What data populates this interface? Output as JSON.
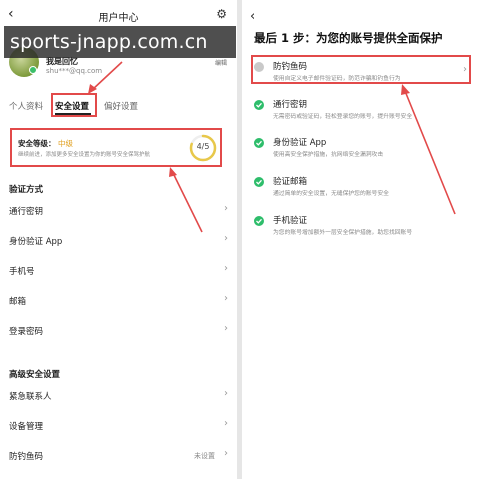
{
  "watermark": "sports-jnapp.com.cn",
  "left": {
    "header": {
      "title": "用户中心"
    },
    "user": {
      "name": "我是回忆",
      "email": "shu***@qq.com",
      "edit": "编辑"
    },
    "tabs": [
      {
        "label": "个人资料"
      },
      {
        "label": "安全设置"
      },
      {
        "label": "偏好设置"
      }
    ],
    "security_level": {
      "label": "安全等级：",
      "value": "中级",
      "description": "继续前进，添加更多安全设置为你的账号安全保驾护航",
      "progress": "4/5",
      "progress_fraction": 0.8
    },
    "verification": {
      "title": "验证方式",
      "items": [
        {
          "label": "通行密钥"
        },
        {
          "label": "身份验证 App"
        },
        {
          "label": "手机号"
        },
        {
          "label": "邮箱"
        },
        {
          "label": "登录密码"
        }
      ]
    },
    "advanced": {
      "title": "高级安全设置",
      "items": [
        {
          "label": "紧急联系人",
          "value": ""
        },
        {
          "label": "设备管理",
          "value": ""
        },
        {
          "label": "防钓鱼码",
          "value": "未设置"
        }
      ]
    }
  },
  "right": {
    "title": "最后 1 步：为您的账号提供全面保护",
    "steps": [
      {
        "title": "防钓鱼码",
        "desc": "使用自定义电子邮件验证码，防范诈骗和钓鱼行为",
        "done": false
      },
      {
        "title": "通行密钥",
        "desc": "无需密码或验证码，轻松登录您的账号，提升账号安全",
        "done": true
      },
      {
        "title": "身份验证 App",
        "desc": "使用高安全保护措施，抗网络安全漏洞攻击",
        "done": true
      },
      {
        "title": "验证邮箱",
        "desc": "通过简单的安全设置，无缝保护您的账号安全",
        "done": true
      },
      {
        "title": "手机验证",
        "desc": "为您的账号增加额外一层安全保护措施，助您找回账号",
        "done": true
      }
    ]
  },
  "colors": {
    "accent_red": "#e24a4a",
    "success_green": "#2ebd6b",
    "level_orange": "#e0a020"
  },
  "icons": [
    "back-arrow-icon",
    "gear-icon",
    "chevron-right-icon",
    "check-circle-icon",
    "pending-circle-icon"
  ]
}
